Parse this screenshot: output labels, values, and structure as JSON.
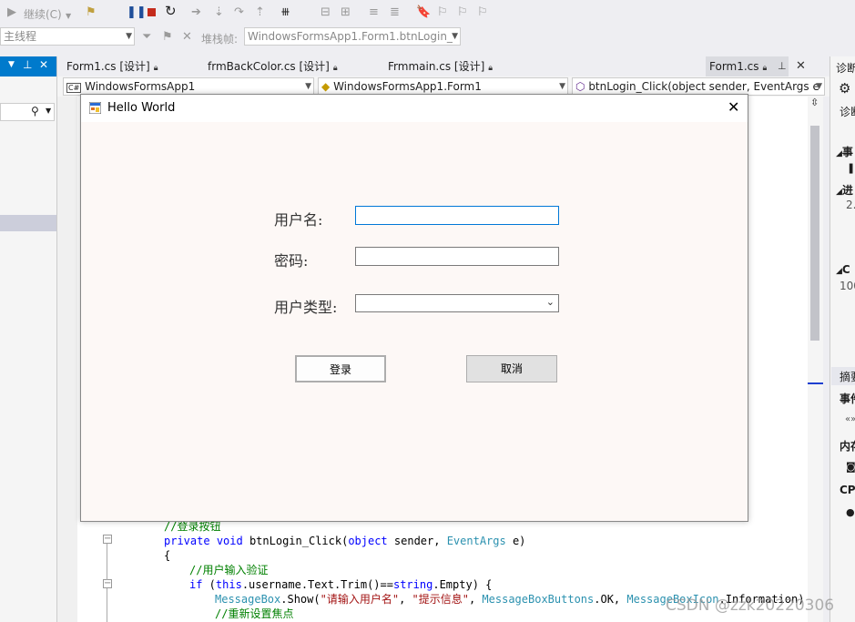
{
  "toolbar": {
    "continue_label": "继续(C)",
    "thread_label": "主线程",
    "stackframe_label": "堆栈帧:",
    "stackframe_value": "WindowsFormsApp1.Form1.btnLogin_"
  },
  "tabs": [
    {
      "label": "Form1.cs [设计]"
    },
    {
      "label": "frmBackColor.cs [设计]"
    },
    {
      "label": "Frmmain.cs [设计]"
    },
    {
      "label": "Form1.cs"
    }
  ],
  "nav": {
    "project": "WindowsFormsApp1",
    "class": "WindowsFormsApp1.Form1",
    "member": "btnLogin_Click(object sender, EventArgs e"
  },
  "dialog": {
    "title": "Hello World",
    "username_label": "用户名:",
    "password_label": "密码:",
    "usertype_label": "用户类型:",
    "login_button": "登录",
    "cancel_button": "取消"
  },
  "code": {
    "line1": "//登录按钮",
    "line2_kw1": "private",
    "line2_kw2": "void",
    "line2_name": " btnLogin_Click(",
    "line2_kw3": "object",
    "line2_mid": " sender, ",
    "line2_type": "EventArgs",
    "line2_end": " e)",
    "line3": "{",
    "line4": "//用户输入验证",
    "line5_kw1": "if",
    "line5_a": " (",
    "line5_kw2": "this",
    "line5_b": ".username.Text.Trim()==",
    "line5_kw3": "string",
    "line5_c": ".Empty) {",
    "line6_t1": "MessageBox",
    "line6_a": ".Show(",
    "line6_s1": "\"请输入用户名\"",
    "line6_b": ", ",
    "line6_s2": "\"提示信息\"",
    "line6_c": ", ",
    "line6_t2": "MessageBoxButtons",
    "line6_d": ".OK, ",
    "line6_t3": "MessageBoxIcon",
    "line6_e": ".Information)",
    "line7": "//重新设置焦点"
  },
  "right_panel": {
    "title": "诊断",
    "diag": "诊断",
    "events": "事",
    "process": "进",
    "value1": "2.",
    "cpu": "C",
    "value2": "100",
    "summary": "摘要",
    "events2": "事件",
    "memory": "内存",
    "cpu2": "CPU"
  },
  "watermark": "CSDN @zzk20220306"
}
